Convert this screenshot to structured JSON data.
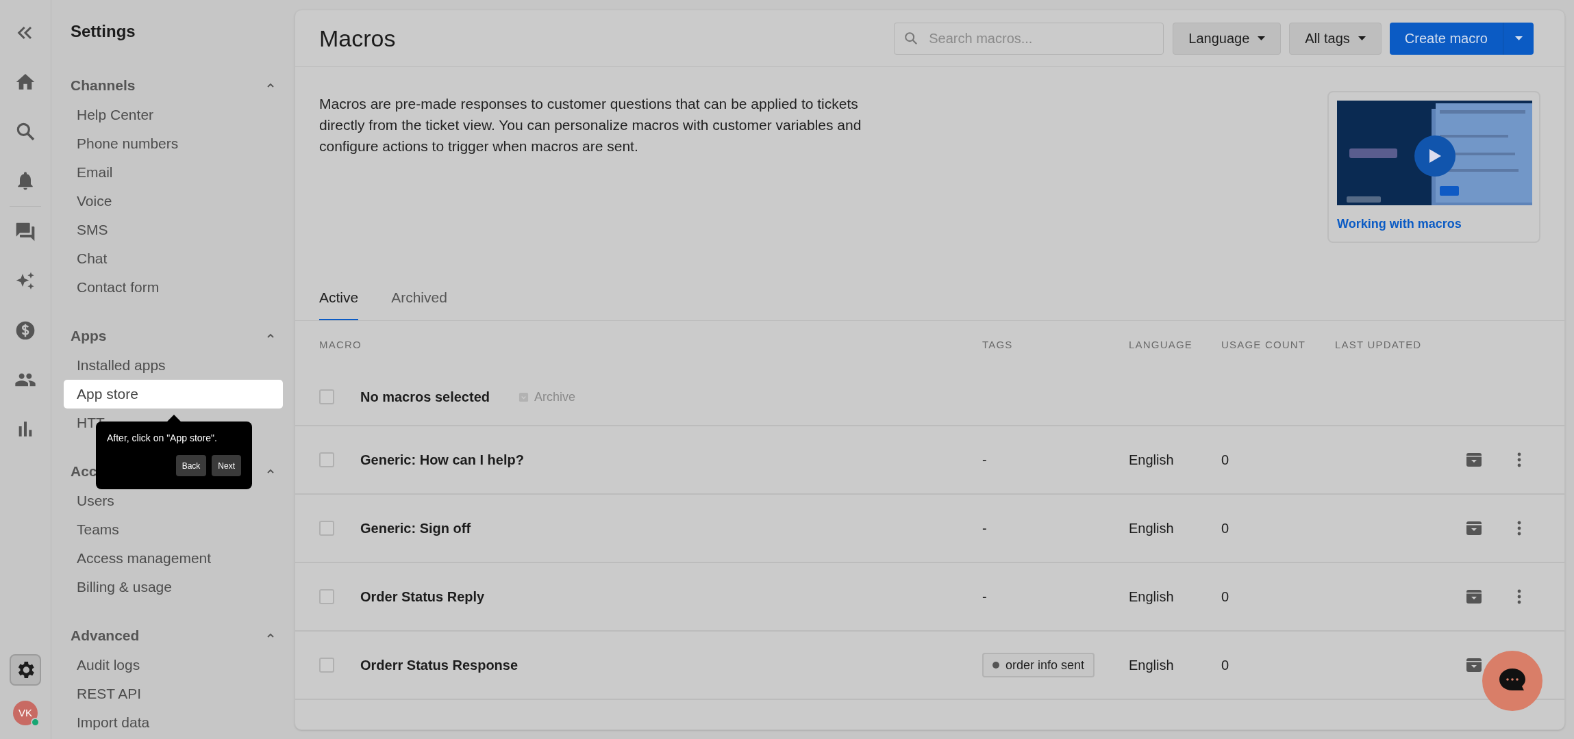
{
  "rail": [
    {
      "kind": "collapse",
      "selected": false
    },
    {
      "kind": "home",
      "selected": false
    },
    {
      "kind": "search",
      "selected": false
    },
    {
      "kind": "bell",
      "selected": false
    },
    {
      "kind": "divider"
    },
    {
      "kind": "chat",
      "selected": false
    },
    {
      "kind": "sparkles",
      "selected": false
    },
    {
      "kind": "dollar",
      "selected": false
    },
    {
      "kind": "people",
      "selected": false
    },
    {
      "kind": "chart",
      "selected": false
    },
    {
      "kind": "spacer"
    },
    {
      "kind": "gear",
      "selected": true
    }
  ],
  "avatar": {
    "initials": "VK",
    "online": true
  },
  "sidebar": {
    "title": "Settings",
    "sections": [
      {
        "title": "Channels",
        "expanded": true,
        "items": [
          {
            "label": "Help Center",
            "selected": false
          },
          {
            "label": "Phone numbers",
            "selected": false
          },
          {
            "label": "Email",
            "selected": false
          },
          {
            "label": "Voice",
            "selected": false
          },
          {
            "label": "SMS",
            "selected": false
          },
          {
            "label": "Chat",
            "selected": false
          },
          {
            "label": "Contact form",
            "selected": false
          }
        ]
      },
      {
        "title": "Apps",
        "expanded": true,
        "items": [
          {
            "label": "Installed apps",
            "selected": false
          },
          {
            "label": "App store",
            "selected": true
          },
          {
            "label": "HTT",
            "selected": false
          }
        ]
      },
      {
        "title": "Acc",
        "expanded": true,
        "items": [
          {
            "label": "Users",
            "selected": false
          },
          {
            "label": "Teams",
            "selected": false
          },
          {
            "label": "Access management",
            "selected": false
          },
          {
            "label": "Billing & usage",
            "selected": false
          }
        ]
      },
      {
        "title": "Advanced",
        "expanded": true,
        "items": [
          {
            "label": "Audit logs",
            "selected": false
          },
          {
            "label": "REST API",
            "selected": false
          },
          {
            "label": "Import data",
            "selected": false
          }
        ]
      }
    ]
  },
  "tooltip": {
    "text": "After, click on \"App store\".",
    "buttons": [
      "Back",
      "Next"
    ]
  },
  "header": {
    "title": "Macros",
    "search": {
      "placeholder": "Search macros..."
    },
    "filters": [
      "Language",
      "All tags"
    ],
    "primary_button": "Create macro"
  },
  "description": "Macros are pre-made responses to customer questions that can be applied to tickets directly from the ticket view. You can personalize macros with customer variables and configure actions to trigger when macros are sent.",
  "video": {
    "kind": "picture",
    "caption": "Working with macros"
  },
  "tabs": [
    {
      "label": "Active",
      "selected": true
    },
    {
      "label": "Archived",
      "selected": false
    }
  ],
  "table": {
    "columns": [
      "MACRO",
      "TAGS",
      "LANGUAGE",
      "USAGE COUNT",
      "LAST UPDATED"
    ],
    "bulk": {
      "checked": false,
      "label": "No macros selected",
      "action": "Archive",
      "action_disabled": true
    },
    "rows": [
      {
        "checked": false,
        "name": "Generic: How can I help?",
        "tags": "-",
        "language": "English",
        "usage_count": "0",
        "more_options": true
      },
      {
        "checked": false,
        "name": "Generic: Sign off",
        "tags": "-",
        "language": "English",
        "usage_count": "0",
        "more_options": true
      },
      {
        "checked": false,
        "name": "Order Status Reply",
        "tags": "-",
        "language": "English",
        "usage_count": "0",
        "more_options": true
      },
      {
        "checked": false,
        "name": "Orderr Status Response",
        "tags": [
          {
            "label": "order info sent"
          }
        ],
        "language": "English",
        "usage_count": "0"
      }
    ]
  }
}
